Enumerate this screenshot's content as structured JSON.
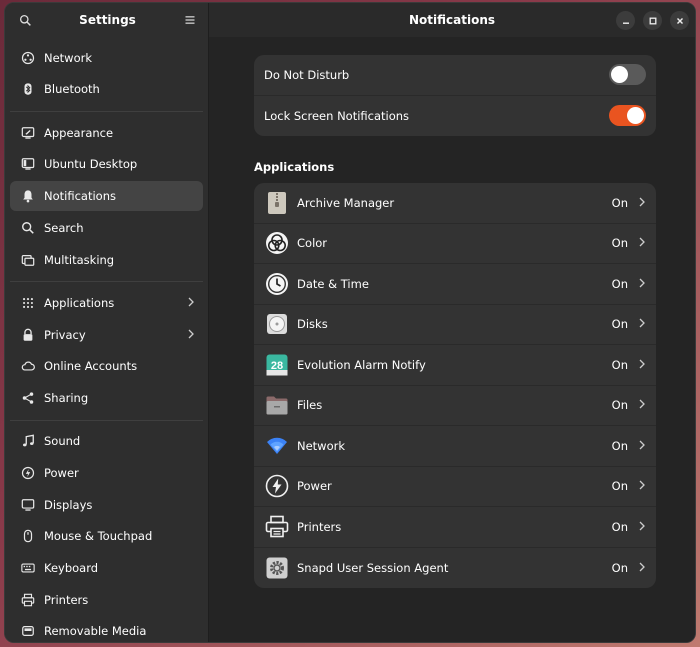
{
  "sidebar": {
    "title": "Settings",
    "groups": [
      [
        {
          "label": "Network",
          "icon": "network-icon"
        },
        {
          "label": "Bluetooth",
          "icon": "bluetooth-icon"
        }
      ],
      [
        {
          "label": "Appearance",
          "icon": "appearance-icon"
        },
        {
          "label": "Ubuntu Desktop",
          "icon": "desktop-icon"
        },
        {
          "label": "Notifications",
          "icon": "bell-icon",
          "active": true
        },
        {
          "label": "Search",
          "icon": "search-icon"
        },
        {
          "label": "Multitasking",
          "icon": "multitasking-icon"
        }
      ],
      [
        {
          "label": "Applications",
          "icon": "apps-grid-icon",
          "chevron": true
        },
        {
          "label": "Privacy",
          "icon": "lock-icon",
          "chevron": true
        },
        {
          "label": "Online Accounts",
          "icon": "cloud-icon"
        },
        {
          "label": "Sharing",
          "icon": "share-icon"
        }
      ],
      [
        {
          "label": "Sound",
          "icon": "music-note-icon"
        },
        {
          "label": "Power",
          "icon": "power-icon"
        },
        {
          "label": "Displays",
          "icon": "display-icon"
        },
        {
          "label": "Mouse & Touchpad",
          "icon": "mouse-icon"
        },
        {
          "label": "Keyboard",
          "icon": "keyboard-icon"
        },
        {
          "label": "Printers",
          "icon": "printer-icon"
        },
        {
          "label": "Removable Media",
          "icon": "removable-media-icon"
        }
      ]
    ]
  },
  "main": {
    "title": "Notifications",
    "dnd_label": "Do Not Disturb",
    "dnd_on": false,
    "lock_label": "Lock Screen Notifications",
    "lock_on": true,
    "accent": "#e95420",
    "toggle_off": "#5a5a5a",
    "apps_title": "Applications",
    "apps": [
      {
        "label": "Archive Manager",
        "state": "On",
        "icon": "archive-icon"
      },
      {
        "label": "Color",
        "state": "On",
        "icon": "color-icon"
      },
      {
        "label": "Date & Time",
        "state": "On",
        "icon": "clock-icon"
      },
      {
        "label": "Disks",
        "state": "On",
        "icon": "disks-icon"
      },
      {
        "label": "Evolution Alarm Notify",
        "state": "On",
        "icon": "calendar-icon",
        "icon_text": "28"
      },
      {
        "label": "Files",
        "state": "On",
        "icon": "folder-icon"
      },
      {
        "label": "Network",
        "state": "On",
        "icon": "wifi-icon"
      },
      {
        "label": "Power",
        "state": "On",
        "icon": "power-app-icon"
      },
      {
        "label": "Printers",
        "state": "On",
        "icon": "printer-app-icon"
      },
      {
        "label": "Snapd User Session Agent",
        "state": "On",
        "icon": "gear-app-icon"
      }
    ]
  }
}
